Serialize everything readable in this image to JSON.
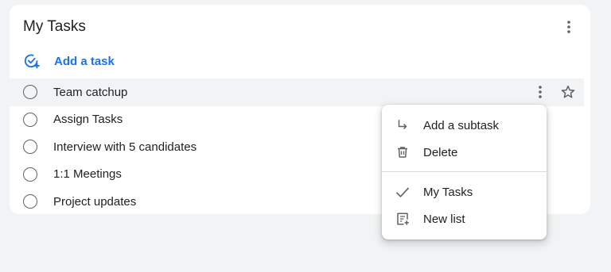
{
  "list": {
    "title": "My Tasks",
    "add_task_label": "Add a task"
  },
  "tasks": [
    {
      "title": "Team catchup"
    },
    {
      "title": "Assign Tasks"
    },
    {
      "title": "Interview with 5 candidates"
    },
    {
      "title": "1:1 Meetings"
    },
    {
      "title": "Project updates"
    }
  ],
  "menu": {
    "items": [
      {
        "label": "Add a subtask",
        "icon": "subdirectory-arrow-icon"
      },
      {
        "label": "Delete",
        "icon": "trash-icon"
      },
      {
        "label": "My Tasks",
        "icon": "checkmark-icon",
        "selected": true
      },
      {
        "label": "New list",
        "icon": "new-list-icon"
      }
    ]
  },
  "colors": {
    "accent": "#1a73e8",
    "background": "#f1f3f4",
    "card": "#ffffff",
    "text": "#202124",
    "icon": "#5f6368"
  }
}
